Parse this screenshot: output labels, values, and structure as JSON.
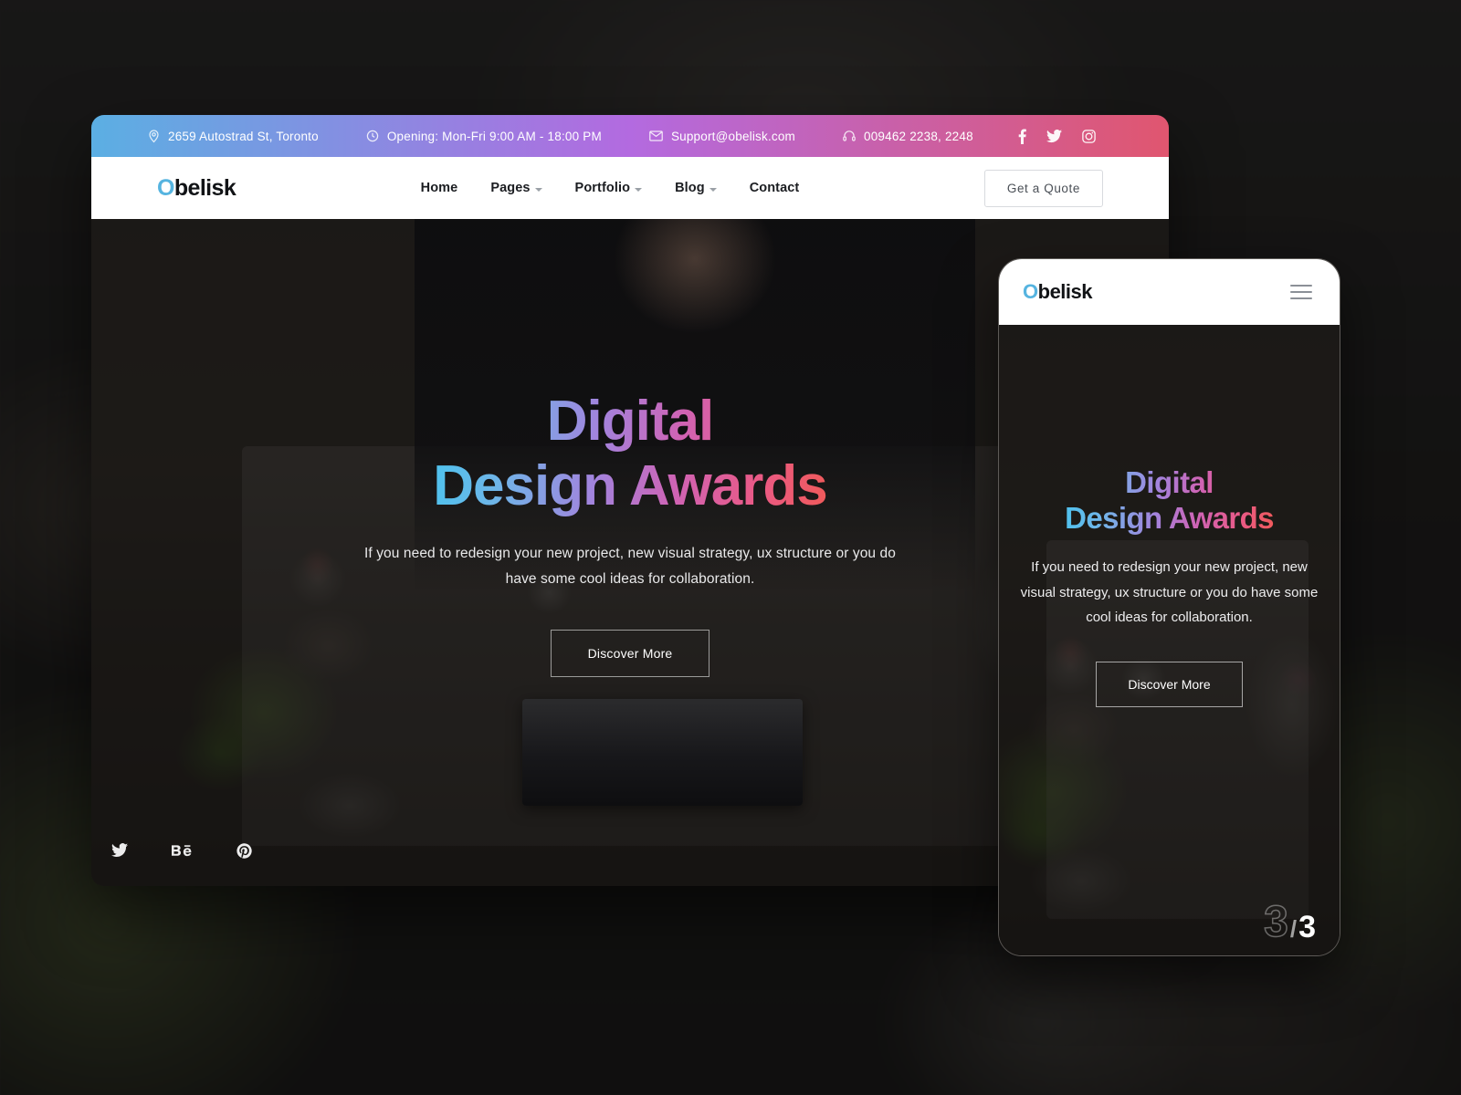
{
  "brand": {
    "name_prefix": "O",
    "name_rest": "belisk",
    "accent_color": "#56b4e0"
  },
  "topbar": {
    "gradient": {
      "from": "#5bafe3",
      "mid": "#b36ae0",
      "to": "#e0566f"
    },
    "items": [
      {
        "icon": "map-pin-icon",
        "text": "2659 Autostrad St, Toronto"
      },
      {
        "icon": "clock-icon",
        "text": "Opening: Mon-Fri 9:00 AM - 18:00 PM"
      },
      {
        "icon": "envelope-icon",
        "text": "Support@obelisk.com"
      },
      {
        "icon": "headset-icon",
        "text": "009462 2238, 2248"
      }
    ],
    "social": [
      {
        "icon": "facebook-icon",
        "label": "Facebook"
      },
      {
        "icon": "twitter-icon",
        "label": "Twitter"
      },
      {
        "icon": "instagram-icon",
        "label": "Instagram"
      }
    ]
  },
  "nav": {
    "links": [
      {
        "label": "Home",
        "has_dropdown": false
      },
      {
        "label": "Pages",
        "has_dropdown": true
      },
      {
        "label": "Portfolio",
        "has_dropdown": true
      },
      {
        "label": "Blog",
        "has_dropdown": true
      },
      {
        "label": "Contact",
        "has_dropdown": false
      }
    ],
    "cta": "Get a Quote"
  },
  "hero": {
    "title_line1": "Digital",
    "title_line2": "Design Awards",
    "paragraph": "If you need to redesign your new project, new visual strategy, ux structure or you do have some cool ideas for collaboration.",
    "button": "Discover More",
    "gradient": {
      "from": "#4cc3ee",
      "mid": "#a383dd",
      "to": "#f05a5a"
    },
    "social": [
      {
        "icon": "twitter-icon",
        "label": "Twitter"
      },
      {
        "icon": "behance-icon",
        "label": "Behance"
      },
      {
        "icon": "pinterest-icon",
        "label": "Pinterest"
      }
    ]
  },
  "mobile": {
    "menu_icon": "hamburger-menu-icon",
    "title_line1": "Digital",
    "title_line2": "Design Awards",
    "paragraph": "If you need to redesign your new project, new visual strategy, ux structure or you do have some cool ideas for collaboration.",
    "button": "Discover More",
    "slide_counter": {
      "current": "3",
      "separator": "/",
      "total": "3"
    }
  }
}
